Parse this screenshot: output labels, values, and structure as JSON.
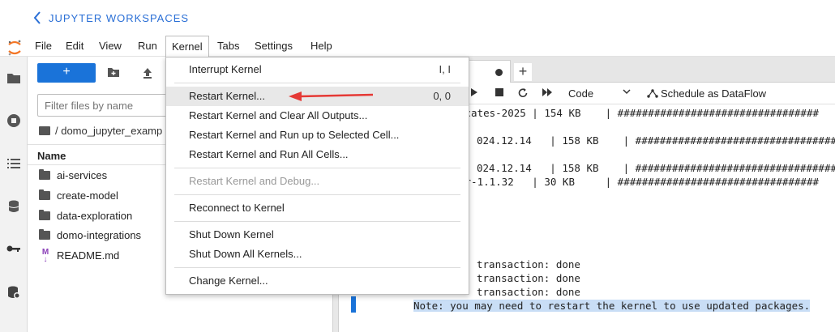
{
  "header": {
    "breadcrumb": "JUPYTER WORKSPACES"
  },
  "menubar": {
    "items": [
      "File",
      "Edit",
      "View",
      "Run",
      "Kernel",
      "Tabs",
      "Settings",
      "Help"
    ],
    "active": "Kernel"
  },
  "file_browser": {
    "new_button": "+",
    "filter_placeholder": "Filter files by name",
    "path": "/ domo_jupyter_examp",
    "column_name": "Name",
    "files": [
      {
        "name": "ai-services",
        "icon": "folder-icon"
      },
      {
        "name": "create-model",
        "icon": "folder-icon"
      },
      {
        "name": "data-exploration",
        "icon": "folder-icon"
      },
      {
        "name": "domo-integrations",
        "icon": "folder-icon"
      },
      {
        "name": "README.md",
        "icon": "markdown-icon"
      }
    ]
  },
  "notebook": {
    "tab_plus": "+",
    "cell_type": "Code",
    "schedule_button": "Schedule as DataFlow",
    "output": [
      "icates-2025 | 154 KB    | #################################",
      "024.12.14   | 158 KB    | #################################",
      "024.12.14   | 158 KB    | #################################",
      "er-1.1.32   | 30 KB     | #################################",
      "transaction: done",
      "transaction: done",
      "transaction: done",
      "Note: you may need to restart the kernel to use updated packages."
    ]
  },
  "kernel_menu": {
    "items": [
      {
        "label": "Interrupt Kernel",
        "shortcut": "I, I"
      },
      {
        "label": "Restart Kernel...",
        "shortcut": "0, 0"
      },
      {
        "label": "Restart Kernel and Clear All Outputs...",
        "shortcut": ""
      },
      {
        "label": "Restart Kernel and Run up to Selected Cell...",
        "shortcut": ""
      },
      {
        "label": "Restart Kernel and Run All Cells...",
        "shortcut": ""
      },
      {
        "label": "Restart Kernel and Debug...",
        "shortcut": ""
      },
      {
        "label": "Reconnect to Kernel",
        "shortcut": ""
      },
      {
        "label": "Shut Down Kernel",
        "shortcut": ""
      },
      {
        "label": "Shut Down All Kernels...",
        "shortcut": ""
      },
      {
        "label": "Change Kernel...",
        "shortcut": ""
      }
    ],
    "hovered": "Restart Kernel...",
    "disabled": [
      "Restart Kernel and Debug..."
    ]
  },
  "colors": {
    "accent": "#1a73d9",
    "arrow": "#e53935",
    "highlight": "#c9def6"
  }
}
